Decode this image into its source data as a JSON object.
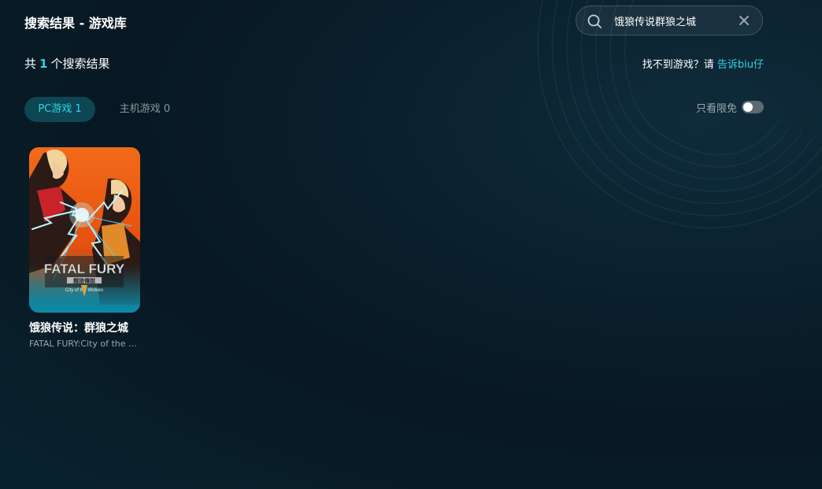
{
  "page": {
    "title": "搜索结果 - 游戏库"
  },
  "search": {
    "value": "饿狼传说群狼之城",
    "search_icon": "search-icon",
    "clear_icon": "close-icon"
  },
  "results": {
    "prefix": "共",
    "count": "1",
    "suffix": "个搜索结果"
  },
  "feedback": {
    "text": "找不到游戏？请",
    "link": "告诉biu仔"
  },
  "tabs": [
    {
      "label": "PC游戏 1",
      "active": true
    },
    {
      "label": "主机游戏 0",
      "active": false
    }
  ],
  "filter": {
    "free_only_label": "只看限免",
    "free_only_on": false
  },
  "games": [
    {
      "title": "饿狼传说：群狼之城",
      "subtitle": "FATAL FURY:City of the Wolves",
      "cover_logo": "FATAL FURY",
      "cover_logo_cn": "餓狼傳說",
      "cover_logo_sub": "City of the Wolves"
    }
  ],
  "colors": {
    "accent": "#2ad6e6",
    "background": "#0a1f2c",
    "tab_active_bg": "#0e4654",
    "cover_orange": "#f05a12"
  }
}
